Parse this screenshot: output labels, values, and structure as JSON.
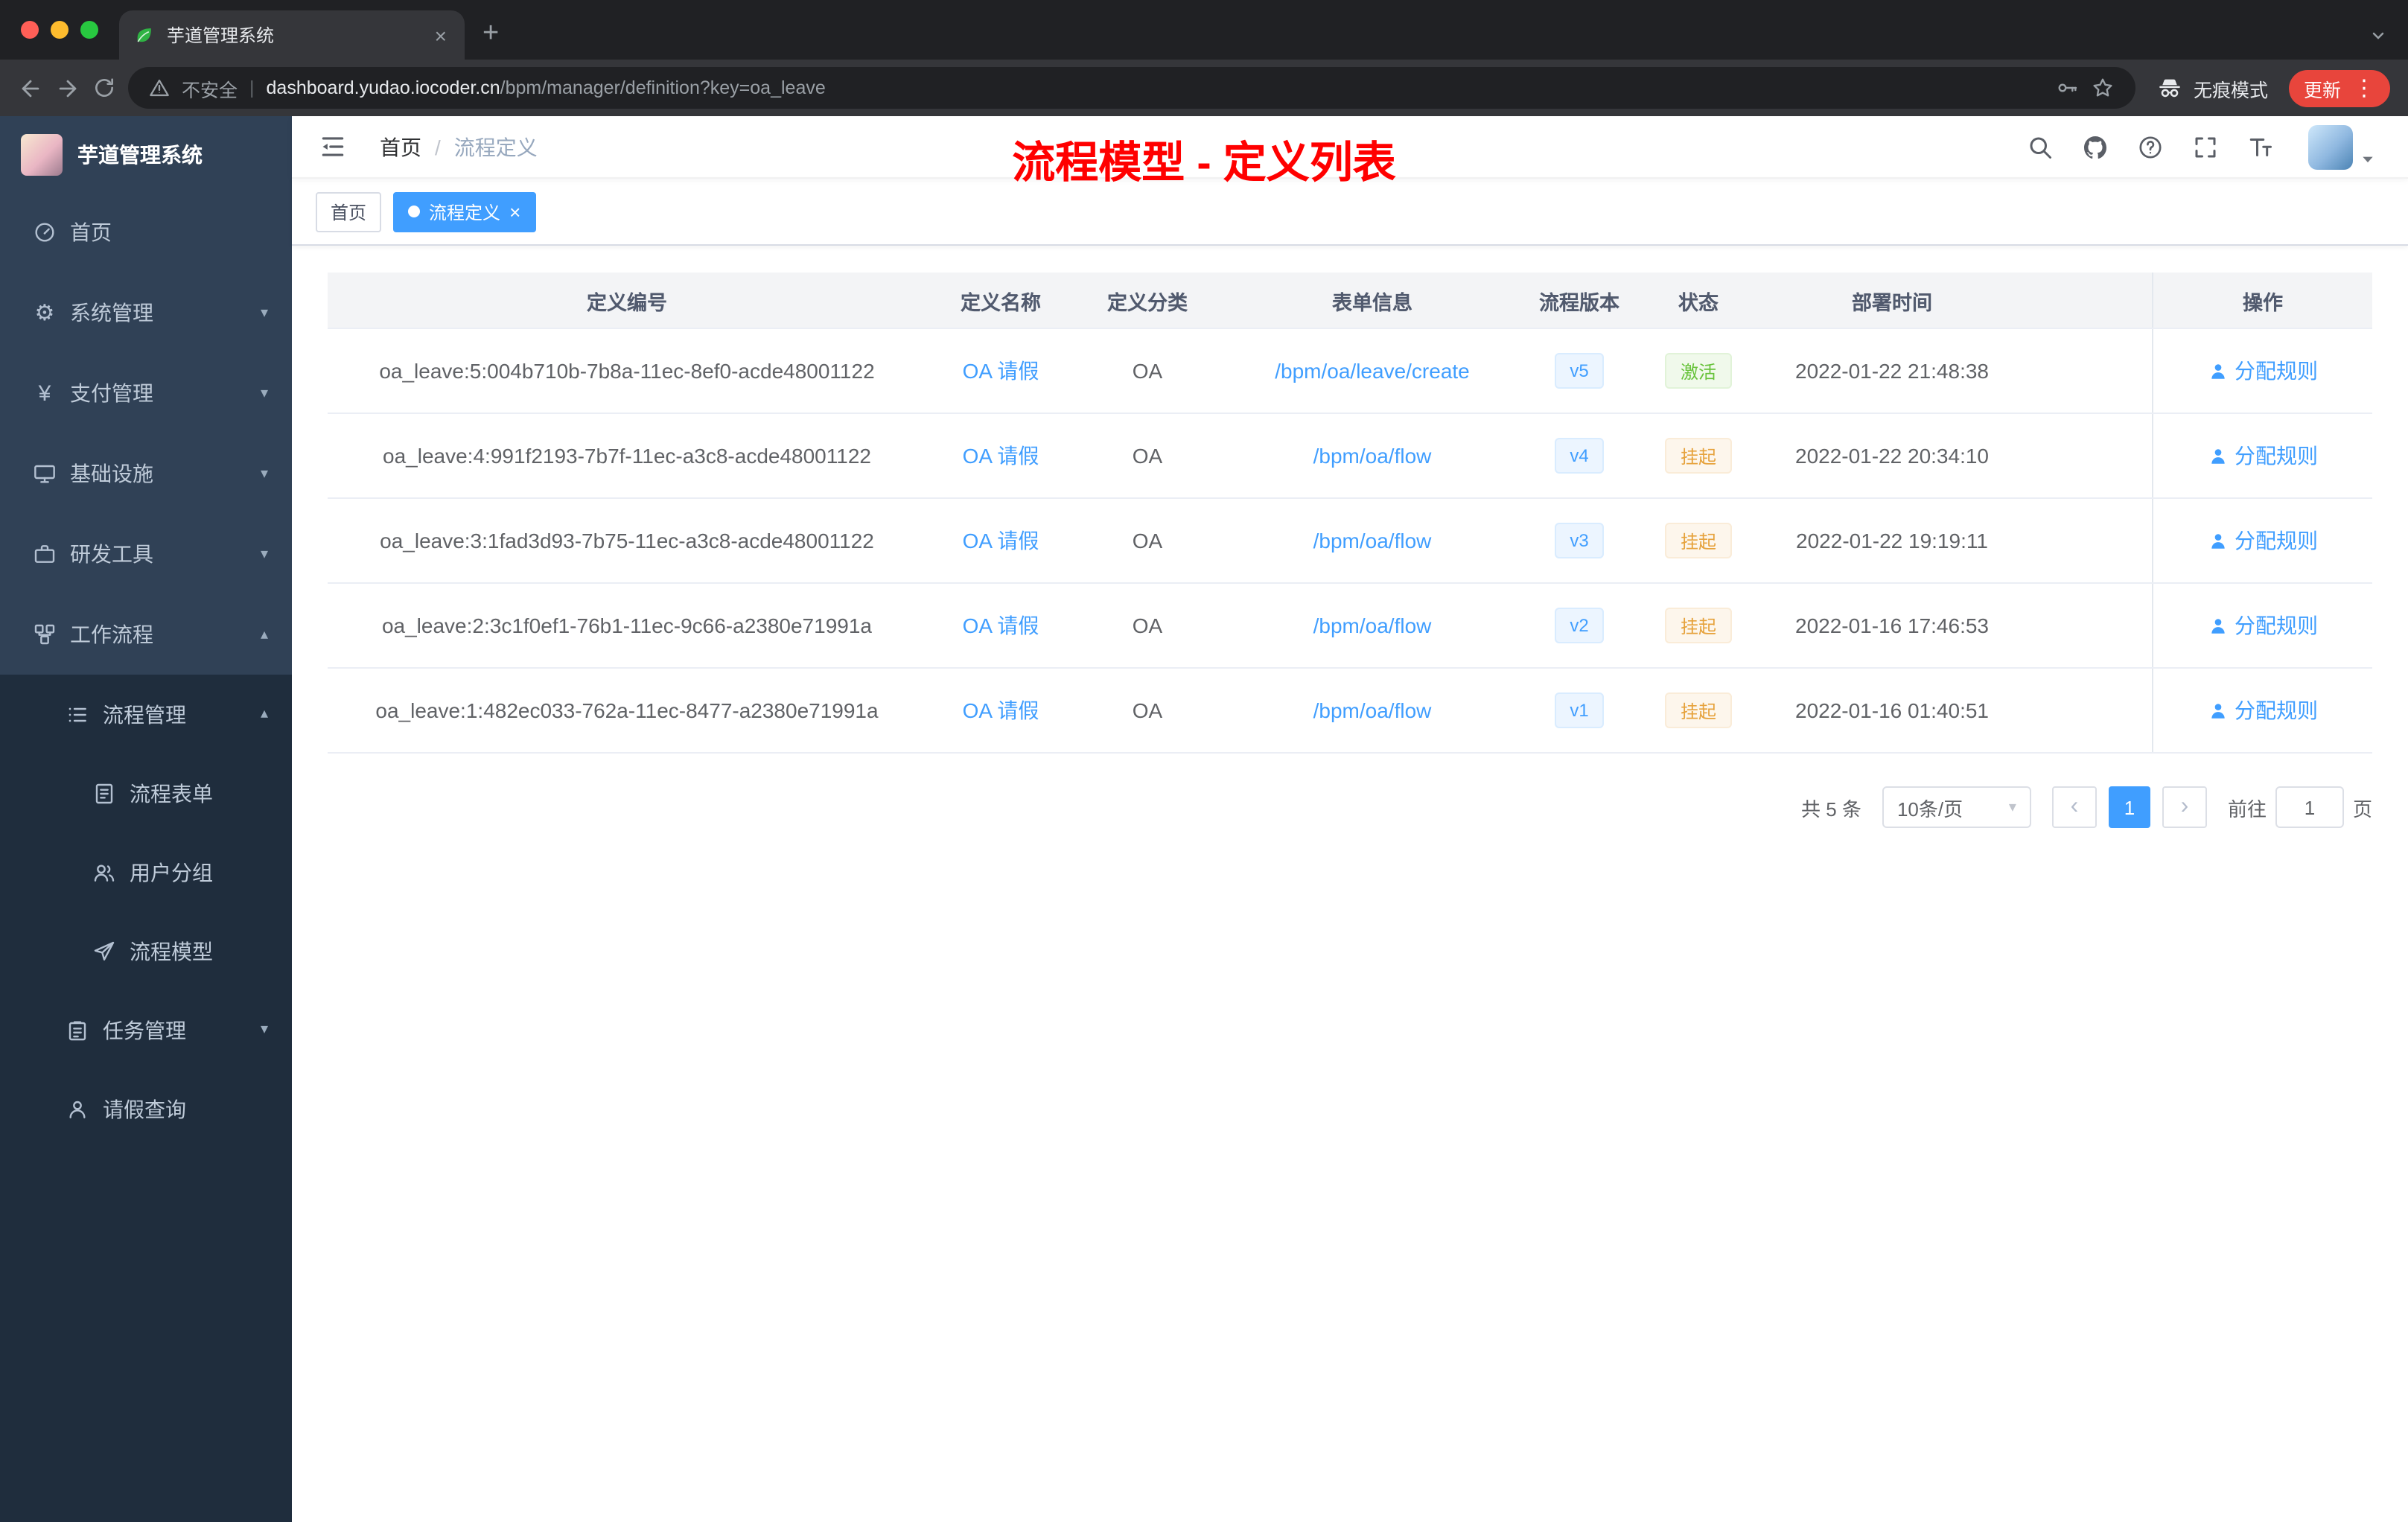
{
  "browser": {
    "tab_title": "芋道管理系统",
    "security_label": "不安全",
    "url_domain": "dashboard.yudao.iocoder.cn",
    "url_path": "/bpm/manager/definition?key=oa_leave",
    "incognito_label": "无痕模式",
    "update_label": "更新"
  },
  "glyphs": {
    "close": "×",
    "plus": "+",
    "gear": "⚙",
    "yen": "¥",
    "caret_down": "▾",
    "caret_up": "▴",
    "chevron_left": "‹",
    "chevron_right": "›",
    "kebab": "⋮",
    "pipe": "|"
  },
  "sidebar": {
    "app_title": "芋道管理系统",
    "menu": [
      {
        "label": "首页"
      },
      {
        "label": "系统管理"
      },
      {
        "label": "支付管理"
      },
      {
        "label": "基础设施"
      },
      {
        "label": "研发工具"
      },
      {
        "label": "工作流程"
      },
      {
        "label": "流程管理"
      },
      {
        "label": "流程表单"
      },
      {
        "label": "用户分组"
      },
      {
        "label": "流程模型"
      },
      {
        "label": "任务管理"
      },
      {
        "label": "请假查询"
      }
    ]
  },
  "header": {
    "breadcrumb_home": "首页",
    "breadcrumb_separator": "/",
    "breadcrumb_current": "流程定义",
    "annotation": "流程模型 - 定义列表"
  },
  "tags": {
    "home": "首页",
    "current": "流程定义"
  },
  "table": {
    "columns": [
      "定义编号",
      "定义名称",
      "定义分类",
      "表单信息",
      "流程版本",
      "状态",
      "部署时间",
      "操作"
    ],
    "rows": [
      {
        "id": "oa_leave:5:004b710b-7b8a-11ec-8ef0-acde48001122",
        "name": "OA 请假",
        "category": "OA",
        "form": "/bpm/oa/leave/create",
        "version": "v5",
        "status": "激活",
        "time": "2022-01-22 21:48:38",
        "action": "分配规则"
      },
      {
        "id": "oa_leave:4:991f2193-7b7f-11ec-a3c8-acde48001122",
        "name": "OA 请假",
        "category": "OA",
        "form": "/bpm/oa/flow",
        "version": "v4",
        "status": "挂起",
        "time": "2022-01-22 20:34:10",
        "action": "分配规则"
      },
      {
        "id": "oa_leave:3:1fad3d93-7b75-11ec-a3c8-acde48001122",
        "name": "OA 请假",
        "category": "OA",
        "form": "/bpm/oa/flow",
        "version": "v3",
        "status": "挂起",
        "time": "2022-01-22 19:19:11",
        "action": "分配规则"
      },
      {
        "id": "oa_leave:2:3c1f0ef1-76b1-11ec-9c66-a2380e71991a",
        "name": "OA 请假",
        "category": "OA",
        "form": "/bpm/oa/flow",
        "version": "v2",
        "status": "挂起",
        "time": "2022-01-16 17:46:53",
        "action": "分配规则"
      },
      {
        "id": "oa_leave:1:482ec033-762a-11ec-8477-a2380e71991a",
        "name": "OA 请假",
        "category": "OA",
        "form": "/bpm/oa/flow",
        "version": "v1",
        "status": "挂起",
        "time": "2022-01-16 01:40:51",
        "action": "分配规则"
      }
    ]
  },
  "pagination": {
    "total": "共 5 条",
    "page_size": "10条/页",
    "current_page": "1",
    "goto_label": "前往",
    "goto_value": "1",
    "page_unit": "页"
  },
  "colors": {
    "accent": "#409eff",
    "annotation": "#ff0000",
    "status_active": "#67c23a",
    "status_suspended": "#e6a23c",
    "sidebar_bg": "#304156",
    "submenu_bg": "#1f2d3d"
  }
}
